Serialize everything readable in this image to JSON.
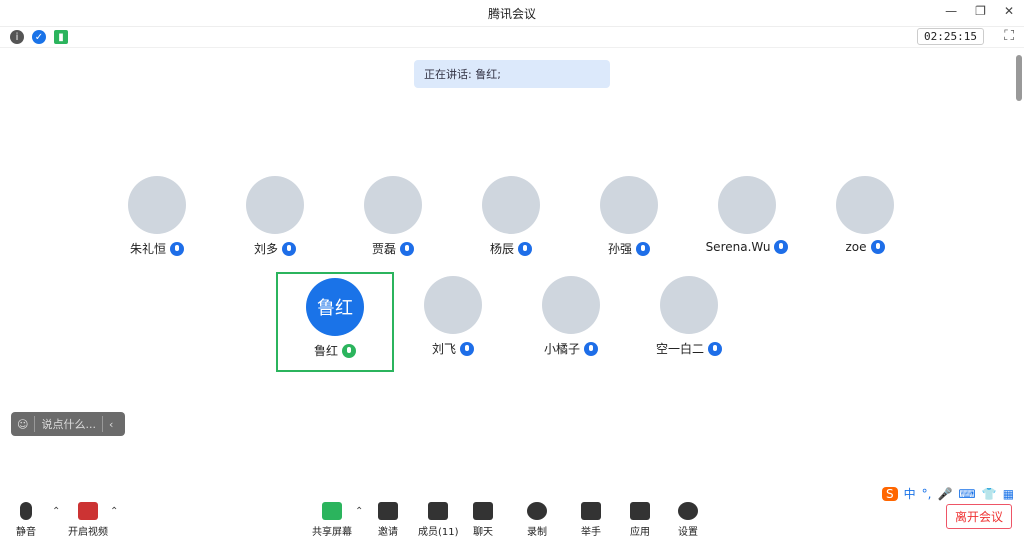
{
  "window": {
    "title": "腾讯会议",
    "timer": "02:25:15"
  },
  "speaking": {
    "text": "正在讲话: 鲁红;"
  },
  "participants": [
    {
      "name": "朱礼恒"
    },
    {
      "name": "刘多"
    },
    {
      "name": "贾磊"
    },
    {
      "name": "杨辰"
    },
    {
      "name": "孙强"
    },
    {
      "name": "Serena.Wu"
    },
    {
      "name": "zoe"
    },
    {
      "name": "鲁红",
      "avatar_text": "鲁红"
    },
    {
      "name": "刘飞"
    },
    {
      "name": "小橘子"
    },
    {
      "name": "空一白二"
    }
  ],
  "chat": {
    "placeholder": "说点什么..."
  },
  "toolbar": {
    "mute": "静音",
    "video": "开启视频",
    "share": "共享屏幕",
    "invite": "邀请",
    "members": "成员(11)",
    "chat": "聊天",
    "record": "录制",
    "raise_hand": "举手",
    "apps": "应用",
    "settings": "设置",
    "leave": "离开会议"
  },
  "ime": {
    "lang": "中"
  }
}
